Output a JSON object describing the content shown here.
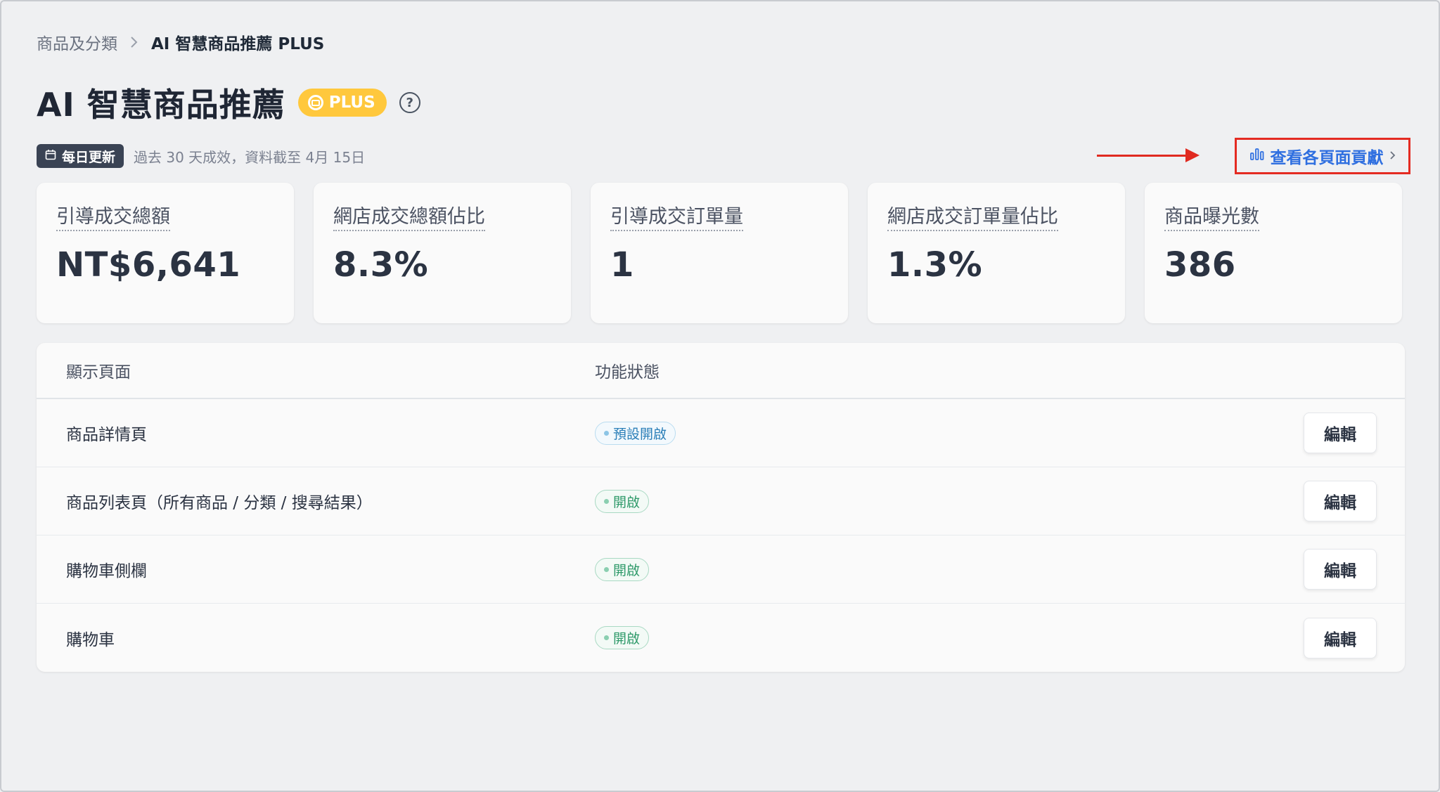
{
  "breadcrumb": {
    "parent": "商品及分類",
    "current": "AI 智慧商品推薦 PLUS"
  },
  "header": {
    "title": "AI 智慧商品推薦",
    "badge": "PLUS",
    "help_icon": "question-circle-icon"
  },
  "subheader": {
    "daily_tag": "每日更新",
    "period_text": "過去 30 天成效，資料截至 4月 15日",
    "contribution_link": "查看各頁面貢獻"
  },
  "stats": [
    {
      "label": "引導成交總額",
      "value": "NT$6,641"
    },
    {
      "label": "網店成交總額佔比",
      "value": "8.3%"
    },
    {
      "label": "引導成交訂單量",
      "value": "1"
    },
    {
      "label": "網店成交訂單量佔比",
      "value": "1.3%"
    },
    {
      "label": "商品曝光數",
      "value": "386"
    }
  ],
  "table": {
    "columns": [
      "顯示頁面",
      "功能狀態"
    ],
    "rows": [
      {
        "page": "商品詳情頁",
        "status": "預設開啟",
        "action": "編輯"
      },
      {
        "page": "商品列表頁（所有商品 / 分類 / 搜尋結果）",
        "status": "開啟",
        "action": "編輯"
      },
      {
        "page": "購物車側欄",
        "status": "開啟",
        "action": "編輯"
      },
      {
        "page": "購物車",
        "status": "開啟",
        "action": "編輯"
      }
    ]
  },
  "colors": {
    "badge": "#ffc83d",
    "link": "#2f6fe0",
    "highlight": "#e42b22",
    "status_default": "#2b7fb8",
    "status_on": "#2f9a6a"
  }
}
